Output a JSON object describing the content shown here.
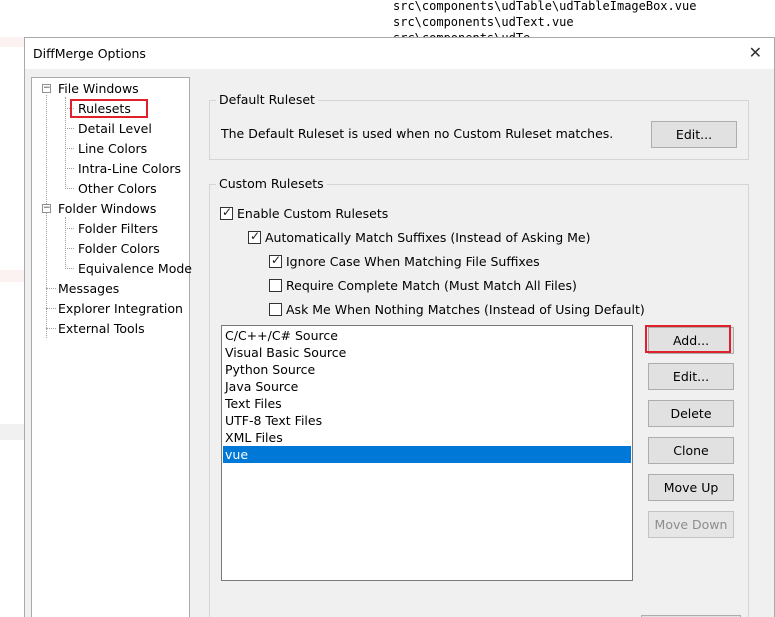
{
  "background": {
    "lines": [
      "src\\components\\udTable\\udTableImageBox.vue",
      "src\\components\\udText.vue",
      "src\\components\\udTe..."
    ]
  },
  "dialog": {
    "title": "DiffMerge Options",
    "close_glyph": "✕"
  },
  "tree": {
    "items": [
      {
        "label": "File Windows",
        "expander": "−"
      },
      {
        "label": "Rulesets"
      },
      {
        "label": "Detail Level"
      },
      {
        "label": "Line Colors"
      },
      {
        "label": "Intra-Line Colors"
      },
      {
        "label": "Other Colors"
      },
      {
        "label": "Folder Windows",
        "expander": "−"
      },
      {
        "label": "Folder Filters"
      },
      {
        "label": "Folder Colors"
      },
      {
        "label": "Equivalence Mode"
      },
      {
        "label": "Messages"
      },
      {
        "label": "Explorer Integration"
      },
      {
        "label": "External Tools"
      }
    ],
    "selected": "Rulesets"
  },
  "default_ruleset": {
    "group_label": "Default Ruleset",
    "description": "The Default Ruleset is used when no Custom Ruleset matches.",
    "edit_label": "Edit..."
  },
  "custom_rulesets": {
    "group_label": "Custom Rulesets",
    "checkboxes": [
      {
        "label": "Enable Custom Rulesets",
        "checked": true
      },
      {
        "label": "Automatically Match Suffixes (Instead of Asking Me)",
        "checked": true
      },
      {
        "label": "Ignore Case When Matching File Suffixes",
        "checked": true
      },
      {
        "label": "Require Complete Match (Must Match All Files)",
        "checked": false
      },
      {
        "label": "Ask Me When Nothing Matches (Instead of Using Default)",
        "checked": false
      }
    ],
    "list": [
      "C/C++/C# Source",
      "Visual Basic Source",
      "Python Source",
      "Java Source",
      "Text Files",
      "UTF-8 Text Files",
      "XML Files",
      "vue"
    ],
    "selected_item": "vue",
    "buttons": {
      "add": "Add...",
      "edit": "Edit...",
      "delete": "Delete",
      "clone": "Clone",
      "move_up": "Move Up",
      "move_down": "Move Down"
    }
  },
  "colors": {
    "selection": "#0078d7",
    "highlight_outline": "#e0202a"
  }
}
